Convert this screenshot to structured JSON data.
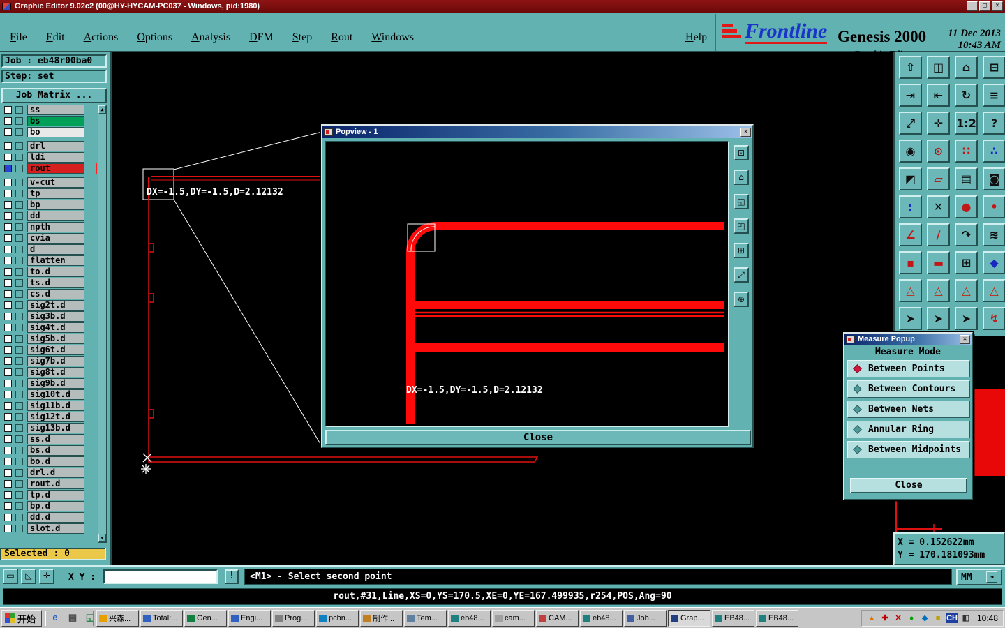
{
  "glyphs": {
    "close": "✕",
    "minimize": "_",
    "maximize": "□",
    "scroll_up": "▲",
    "scroll_down": "▼",
    "mm_arrow": "◄"
  },
  "window": {
    "title": "Graphic Editor 9.02c2 (00@HY-HYCAM-PC037 - Windows, pid:1980)"
  },
  "menu": {
    "items": [
      "File",
      "Edit",
      "Actions",
      "Options",
      "Analysis",
      "DFM",
      "Step",
      "Rout",
      "Windows"
    ],
    "help": "Help"
  },
  "branding": {
    "logo_text": "Frontline",
    "product": "Genesis 2000",
    "subtitle": "Graphic Editor",
    "date": "11 Dec 2013",
    "time": "10:43 AM"
  },
  "left_panel": {
    "job_label": "Job : eb48r00ba0",
    "step_label": "Step: set",
    "job_matrix_button": "Job Matrix ...",
    "selected_label": "Selected : 0",
    "layers": [
      {
        "name": "ss",
        "bg": "#b4bcbc"
      },
      {
        "name": "bs",
        "bg": "#00a058"
      },
      {
        "name": "bo",
        "bg": "#e9e9e9"
      },
      {
        "name": "drl",
        "bg": "#b4bcbc",
        "gap_before": true
      },
      {
        "name": "ldi",
        "bg": "#b4bcbc"
      },
      {
        "name": "rout",
        "bg": "#d62020",
        "selected": true
      },
      {
        "name": "v-cut",
        "bg": "#b4bcbc",
        "gap_before": true
      },
      {
        "name": "tp",
        "bg": "#b4bcbc"
      },
      {
        "name": "bp",
        "bg": "#b4bcbc"
      },
      {
        "name": "dd",
        "bg": "#b4bcbc"
      },
      {
        "name": "npth",
        "bg": "#b4bcbc"
      },
      {
        "name": "cvia",
        "bg": "#b4bcbc"
      },
      {
        "name": "d",
        "bg": "#b4bcbc"
      },
      {
        "name": "flatten",
        "bg": "#b4bcbc"
      },
      {
        "name": "to.d",
        "bg": "#b4bcbc"
      },
      {
        "name": "ts.d",
        "bg": "#b4bcbc"
      },
      {
        "name": "cs.d",
        "bg": "#b4bcbc"
      },
      {
        "name": "sig2t.d",
        "bg": "#b4bcbc"
      },
      {
        "name": "sig3b.d",
        "bg": "#b4bcbc"
      },
      {
        "name": "sig4t.d",
        "bg": "#b4bcbc"
      },
      {
        "name": "sig5b.d",
        "bg": "#b4bcbc"
      },
      {
        "name": "sig6t.d",
        "bg": "#b4bcbc"
      },
      {
        "name": "sig7b.d",
        "bg": "#b4bcbc"
      },
      {
        "name": "sig8t.d",
        "bg": "#b4bcbc"
      },
      {
        "name": "sig9b.d",
        "bg": "#b4bcbc"
      },
      {
        "name": "sig10t.d",
        "bg": "#b4bcbc"
      },
      {
        "name": "sig11b.d",
        "bg": "#b4bcbc"
      },
      {
        "name": "sig12t.d",
        "bg": "#b4bcbc"
      },
      {
        "name": "sig13b.d",
        "bg": "#b4bcbc"
      },
      {
        "name": "ss.d",
        "bg": "#b4bcbc"
      },
      {
        "name": "bs.d",
        "bg": "#b4bcbc"
      },
      {
        "name": "bo.d",
        "bg": "#b4bcbc"
      },
      {
        "name": "drl.d",
        "bg": "#b4bcbc"
      },
      {
        "name": "rout.d",
        "bg": "#b4bcbc"
      },
      {
        "name": "tp.d",
        "bg": "#b4bcbc"
      },
      {
        "name": "bp.d",
        "bg": "#b4bcbc"
      },
      {
        "name": "dd.d",
        "bg": "#b4bcbc"
      },
      {
        "name": "slot.d",
        "bg": "#b4bcbc"
      }
    ]
  },
  "canvas": {
    "measure_text": "DX=-1.5,DY=-1.5,D=2.12132"
  },
  "popview": {
    "title": "Popview - 1",
    "measure_text": "DX=-1.5,DY=-1.5,D=2.12132",
    "close_label": "Close",
    "tools": [
      {
        "g": "⊡"
      },
      {
        "g": "⌂"
      },
      {
        "g": "◱"
      },
      {
        "g": "◰"
      },
      {
        "g": "⊞"
      },
      {
        "g": "⤢"
      },
      {
        "g": "⊕"
      }
    ]
  },
  "measure_popup": {
    "title": "Measure Popup",
    "header": "Measure Mode",
    "options": [
      {
        "label": "Between Points",
        "selected": true
      },
      {
        "label": "Between Contours",
        "selected": false
      },
      {
        "label": "Between Nets",
        "selected": false
      },
      {
        "label": "Annular Ring",
        "selected": false
      },
      {
        "label": "Between Midpoints",
        "selected": false
      }
    ],
    "close_label": "Close"
  },
  "right_toolbar": {
    "icons": [
      {
        "g": "⇧",
        "c": "#101010"
      },
      {
        "g": "◫",
        "c": "#101010"
      },
      {
        "g": "⌂",
        "c": "#101010"
      },
      {
        "g": "⊟",
        "c": "#101010"
      },
      {
        "g": "⇥",
        "c": "#101010"
      },
      {
        "g": "⇤",
        "c": "#101010"
      },
      {
        "g": "↻",
        "c": "#101010"
      },
      {
        "g": "≡",
        "c": "#101010"
      },
      {
        "g": "⤢",
        "c": "#101010"
      },
      {
        "g": "✛",
        "c": "#101010"
      },
      {
        "g": "1:2",
        "c": "#101010"
      },
      {
        "g": "?",
        "c": "#101010"
      },
      {
        "g": "◉",
        "c": "#101010"
      },
      {
        "g": "⊙",
        "c": "#b01010"
      },
      {
        "g": "∷",
        "c": "#c01818"
      },
      {
        "g": "∴",
        "c": "#1828c0"
      },
      {
        "g": "◩",
        "c": "#101010"
      },
      {
        "g": "▱",
        "c": "#b01010"
      },
      {
        "g": "▤",
        "c": "#101010"
      },
      {
        "g": "◙",
        "c": "#101010"
      },
      {
        "g": ":",
        "c": "#1828c0"
      },
      {
        "g": "✕",
        "c": "#101010"
      },
      {
        "g": "●",
        "c": "#c01818"
      },
      {
        "g": "•",
        "c": "#c01818"
      },
      {
        "g": "∠",
        "c": "#c01818"
      },
      {
        "g": "∕",
        "c": "#c01818"
      },
      {
        "g": "↷",
        "c": "#101010"
      },
      {
        "g": "≋",
        "c": "#101010"
      },
      {
        "g": "▪",
        "c": "#c01818"
      },
      {
        "g": "▬",
        "c": "#c01818"
      },
      {
        "g": "⊞",
        "c": "#101010"
      },
      {
        "g": "◆",
        "c": "#1828c0"
      },
      {
        "g": "△",
        "c": "#c02810"
      },
      {
        "g": "△",
        "c": "#c02810"
      },
      {
        "g": "△",
        "c": "#c02810"
      },
      {
        "g": "△",
        "c": "#c02810"
      },
      {
        "g": "➤",
        "c": "#101010"
      },
      {
        "g": "➤",
        "c": "#101010"
      },
      {
        "g": "➤",
        "c": "#101010"
      },
      {
        "g": "↯",
        "c": "#c01818"
      }
    ]
  },
  "coords": {
    "x": "X = 0.152622mm",
    "y": "Y = 170.181093mm"
  },
  "statusbar": {
    "tools": [
      {
        "g": "▭"
      },
      {
        "g": "◺"
      },
      {
        "g": "✛"
      }
    ],
    "xy_label": "X Y :",
    "xy_value": "",
    "bang": "!",
    "message": "<M1> - Select second point",
    "units": "MM"
  },
  "infobar": {
    "text": "rout,#31,Line,XS=0,YS=170.5,XE=0,YE=167.499935,r254,POS,Ang=90"
  },
  "taskbar": {
    "start": "开始",
    "quick_launch": [
      {
        "g": "e",
        "c": "#2060c0"
      },
      {
        "g": "▦",
        "c": "#505050"
      },
      {
        "g": "◱",
        "c": "#208040"
      }
    ],
    "tasks": [
      {
        "label": "兴森...",
        "ic": "#e8a000"
      },
      {
        "label": "Total:...",
        "ic": "#3060c0"
      },
      {
        "label": "Gen...",
        "ic": "#108040"
      },
      {
        "label": "Engi...",
        "ic": "#3060c0"
      },
      {
        "label": "Prog...",
        "ic": "#808080"
      },
      {
        "label": "pcbn...",
        "ic": "#1080c0"
      },
      {
        "label": "制作...",
        "ic": "#c08020"
      },
      {
        "label": "Tem...",
        "ic": "#6080a0"
      },
      {
        "label": "eb48...",
        "ic": "#208080"
      },
      {
        "label": "cam...",
        "ic": "#a0a0a0"
      },
      {
        "label": "CAM...",
        "ic": "#c04040"
      },
      {
        "label": "eb48...",
        "ic": "#208080"
      },
      {
        "label": "Job...",
        "ic": "#4060a0"
      },
      {
        "label": "Grap...",
        "ic": "#204080",
        "active": true
      },
      {
        "label": "EB48...",
        "ic": "#208080"
      },
      {
        "label": "EB48...",
        "ic": "#208080"
      }
    ],
    "tray": [
      {
        "g": "▲",
        "c": "#e07000"
      },
      {
        "g": "✚",
        "c": "#c00000"
      },
      {
        "g": "✕",
        "c": "#c00000"
      },
      {
        "g": "●",
        "c": "#00a000"
      },
      {
        "g": "◆",
        "c": "#0070c0"
      },
      {
        "g": "■",
        "c": "#c0a000"
      },
      {
        "g": "CH",
        "c": "#ffffff",
        "bg": "#2040a0"
      },
      {
        "g": "◧",
        "c": "#333333"
      }
    ],
    "clock": "10:48"
  }
}
